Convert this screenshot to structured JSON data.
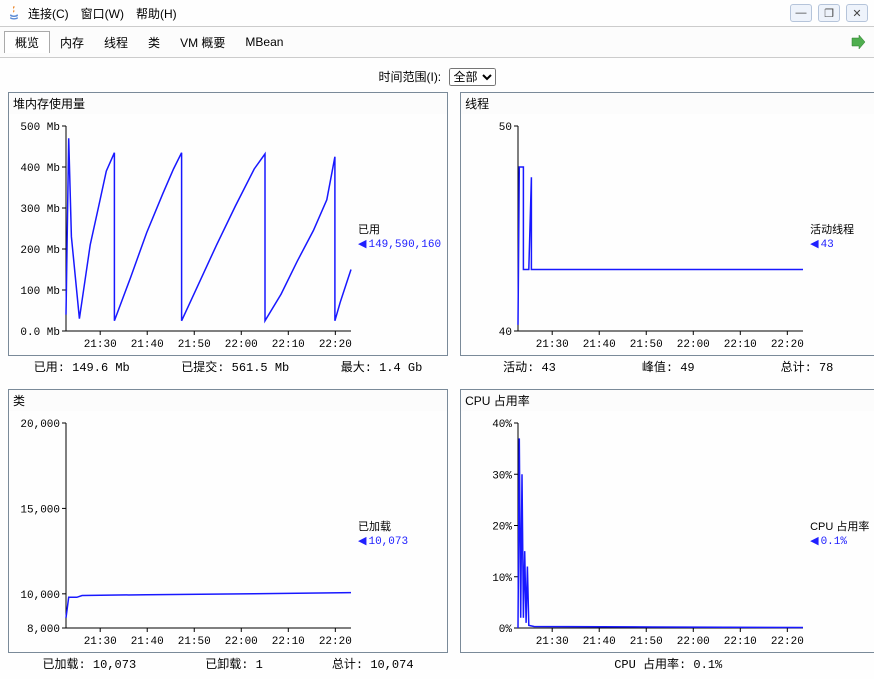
{
  "menu": {
    "connection": "连接(C)",
    "window": "窗口(W)",
    "help": "帮助(H)"
  },
  "tabs": {
    "overview": "概览",
    "memory": "内存",
    "threads": "线程",
    "classes": "类",
    "vmsummary": "VM 概要",
    "mbean": "MBean"
  },
  "time_range_label": "时间范围(I):",
  "time_range_value": "全部",
  "chart_data": [
    {
      "title": "堆内存使用量",
      "type": "line",
      "xlabel": "",
      "ylabel": "",
      "y_ticks": [
        "0.0 Mb",
        "100 Mb",
        "200 Mb",
        "300 Mb",
        "400 Mb",
        "500 Mb"
      ],
      "x_ticks": [
        "21:30",
        "21:40",
        "21:50",
        "22:00",
        "22:10",
        "22:20"
      ],
      "ylim": [
        0,
        500
      ],
      "legend": {
        "name": "已用",
        "value": "149,590,160"
      },
      "series": [
        {
          "name": "已用",
          "points": [
            [
              0.0,
              40
            ],
            [
              0.01,
              470
            ],
            [
              0.02,
              230
            ],
            [
              0.05,
              30
            ],
            [
              0.07,
              120
            ],
            [
              0.09,
              210
            ],
            [
              0.12,
              300
            ],
            [
              0.15,
              390
            ],
            [
              0.18,
              435
            ],
            [
              0.18,
              25
            ],
            [
              0.24,
              130
            ],
            [
              0.3,
              240
            ],
            [
              0.36,
              335
            ],
            [
              0.4,
              395
            ],
            [
              0.43,
              435
            ],
            [
              0.43,
              25
            ],
            [
              0.49,
              110
            ],
            [
              0.56,
              210
            ],
            [
              0.63,
              305
            ],
            [
              0.7,
              395
            ],
            [
              0.74,
              432
            ],
            [
              0.74,
              25
            ],
            [
              0.8,
              90
            ],
            [
              0.86,
              170
            ],
            [
              0.92,
              245
            ],
            [
              0.97,
              320
            ],
            [
              1.0,
              425
            ],
            [
              1.0,
              25
            ],
            [
              1.02,
              70
            ],
            [
              1.04,
              110
            ],
            [
              1.06,
              150
            ]
          ]
        }
      ],
      "stats": [
        {
          "label": "已用:",
          "value": "149.6 Mb"
        },
        {
          "label": "已提交:",
          "value": "561.5 Mb"
        },
        {
          "label": "最大:",
          "value": "1.4 Gb"
        }
      ]
    },
    {
      "title": "线程",
      "type": "line",
      "y_ticks": [
        "40",
        "50"
      ],
      "x_ticks": [
        "21:30",
        "21:40",
        "21:50",
        "22:00",
        "22:10",
        "22:20"
      ],
      "ylim": [
        40,
        50
      ],
      "legend": {
        "name": "活动线程",
        "value": "43"
      },
      "series": [
        {
          "name": "活动线程",
          "points": [
            [
              0.0,
              40.3
            ],
            [
              0.005,
              48
            ],
            [
              0.02,
              48
            ],
            [
              0.02,
              43
            ],
            [
              0.04,
              43
            ],
            [
              0.05,
              47.5
            ],
            [
              0.05,
              43
            ],
            [
              0.08,
              43
            ],
            [
              0.08,
              43
            ],
            [
              1.06,
              43
            ]
          ]
        }
      ],
      "stats": [
        {
          "label": "活动:",
          "value": "43"
        },
        {
          "label": "峰值:",
          "value": "49"
        },
        {
          "label": "总计:",
          "value": "78"
        }
      ]
    },
    {
      "title": "类",
      "type": "line",
      "y_ticks": [
        "8,000",
        "10,000",
        "15,000",
        "20,000"
      ],
      "x_ticks": [
        "21:30",
        "21:40",
        "21:50",
        "22:00",
        "22:10",
        "22:20"
      ],
      "ylim": [
        8000,
        20000
      ],
      "legend": {
        "name": "已加载",
        "value": "10,073"
      },
      "series": [
        {
          "name": "已加载",
          "points": [
            [
              0.0,
              8600
            ],
            [
              0.01,
              9800
            ],
            [
              0.04,
              9800
            ],
            [
              0.06,
              9900
            ],
            [
              0.3,
              9950
            ],
            [
              0.5,
              9980
            ],
            [
              0.7,
              10000
            ],
            [
              1.06,
              10073
            ]
          ]
        }
      ],
      "stats": [
        {
          "label": "已加载:",
          "value": "10,073"
        },
        {
          "label": "已卸载:",
          "value": "1"
        },
        {
          "label": "总计:",
          "value": "10,074"
        }
      ]
    },
    {
      "title": "CPU 占用率",
      "type": "line",
      "y_ticks": [
        "0%",
        "10%",
        "20%",
        "30%",
        "40%"
      ],
      "x_ticks": [
        "21:30",
        "21:40",
        "21:50",
        "22:00",
        "22:10",
        "22:20"
      ],
      "ylim": [
        0,
        40
      ],
      "legend": {
        "name": "CPU 占用率",
        "value": "0.1%"
      },
      "series": [
        {
          "name": "CPU 占用率",
          "points": [
            [
              0.0,
              0
            ],
            [
              0.005,
              37
            ],
            [
              0.01,
              2
            ],
            [
              0.015,
              30
            ],
            [
              0.02,
              2
            ],
            [
              0.025,
              15
            ],
            [
              0.03,
              1
            ],
            [
              0.035,
              12
            ],
            [
              0.04,
              0.5
            ],
            [
              0.06,
              0.3
            ],
            [
              0.5,
              0.2
            ],
            [
              1.06,
              0.1
            ]
          ]
        }
      ],
      "stats": [
        {
          "label": "CPU 占用率:",
          "value": "0.1%"
        }
      ]
    }
  ]
}
